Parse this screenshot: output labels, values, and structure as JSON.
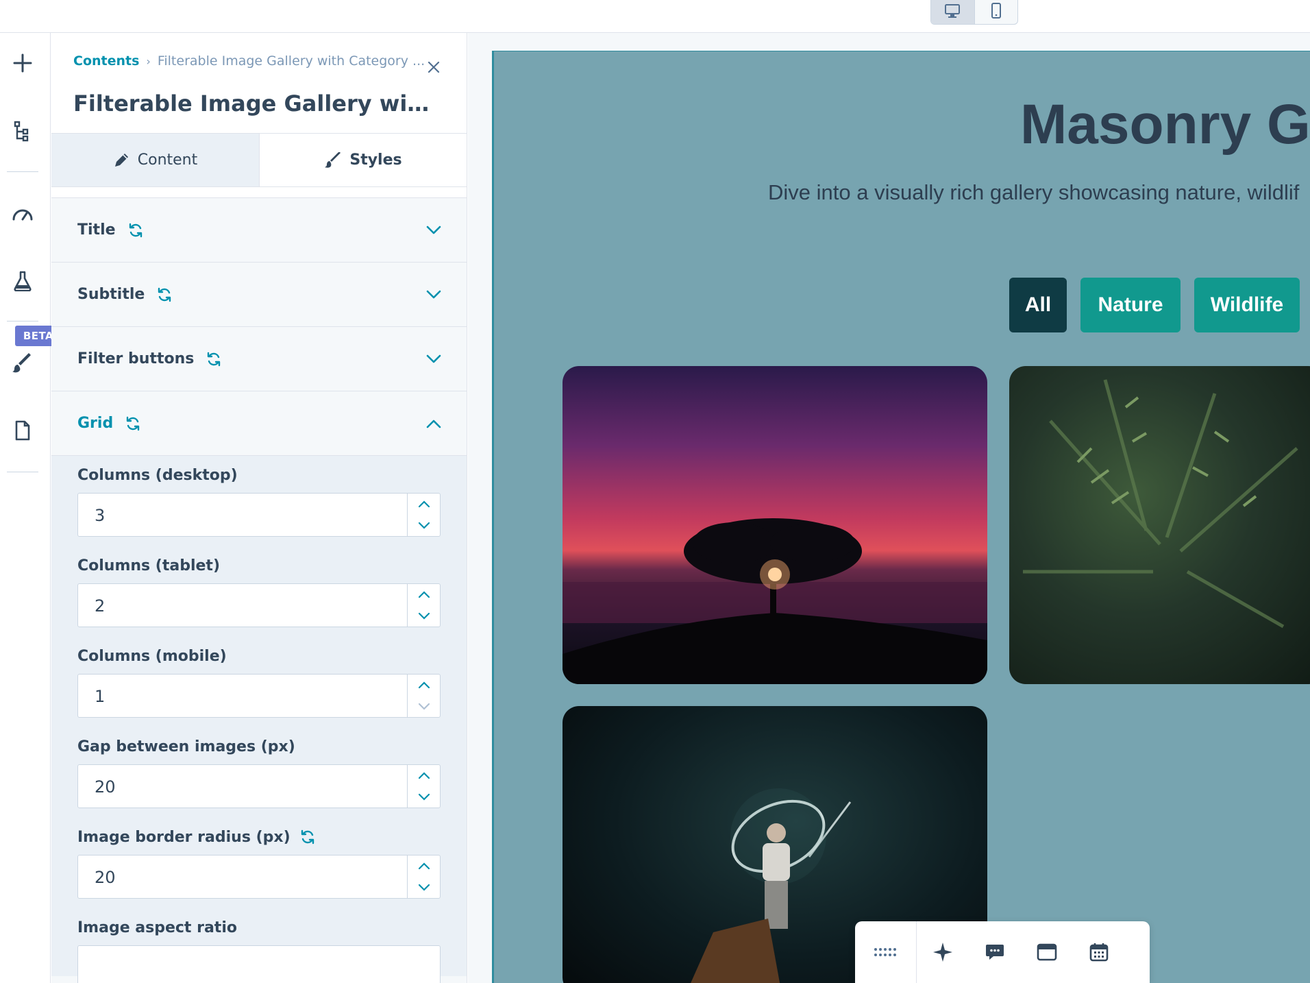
{
  "breadcrumb": {
    "root": "Contents",
    "current": "Filterable Image Gallery with Category ..."
  },
  "panel": {
    "title": "Filterable Image Gallery with C...",
    "tabs": [
      {
        "label": "Content",
        "icon": "pencil-icon",
        "active": true
      },
      {
        "label": "Styles",
        "icon": "brush-icon",
        "active": false
      }
    ],
    "sections": [
      {
        "label": "Title"
      },
      {
        "label": "Subtitle"
      },
      {
        "label": "Filter buttons"
      },
      {
        "label": "Grid",
        "open": true
      }
    ],
    "grid_fields": [
      {
        "label": "Columns (desktop)",
        "value": "3"
      },
      {
        "label": "Columns (tablet)",
        "value": "2"
      },
      {
        "label": "Columns (mobile)",
        "value": "1"
      },
      {
        "label": "Gap between images (px)",
        "value": "20"
      },
      {
        "label": "Image border radius (px)",
        "value": "20"
      },
      {
        "label": "Image aspect ratio"
      }
    ]
  },
  "rail": {
    "badge": "BETA"
  },
  "preview": {
    "title": "Masonry Ga",
    "subtitle": "Dive into a visually rich gallery showcasing nature, wildlif",
    "filters": [
      "All",
      "Nature",
      "Wildlife"
    ]
  },
  "colors": {
    "accent": "#0091ae",
    "page_bg": "#77a4b0",
    "filter_active": "#0f3b44",
    "filter": "#11998e",
    "beta": "#6a78d1"
  }
}
